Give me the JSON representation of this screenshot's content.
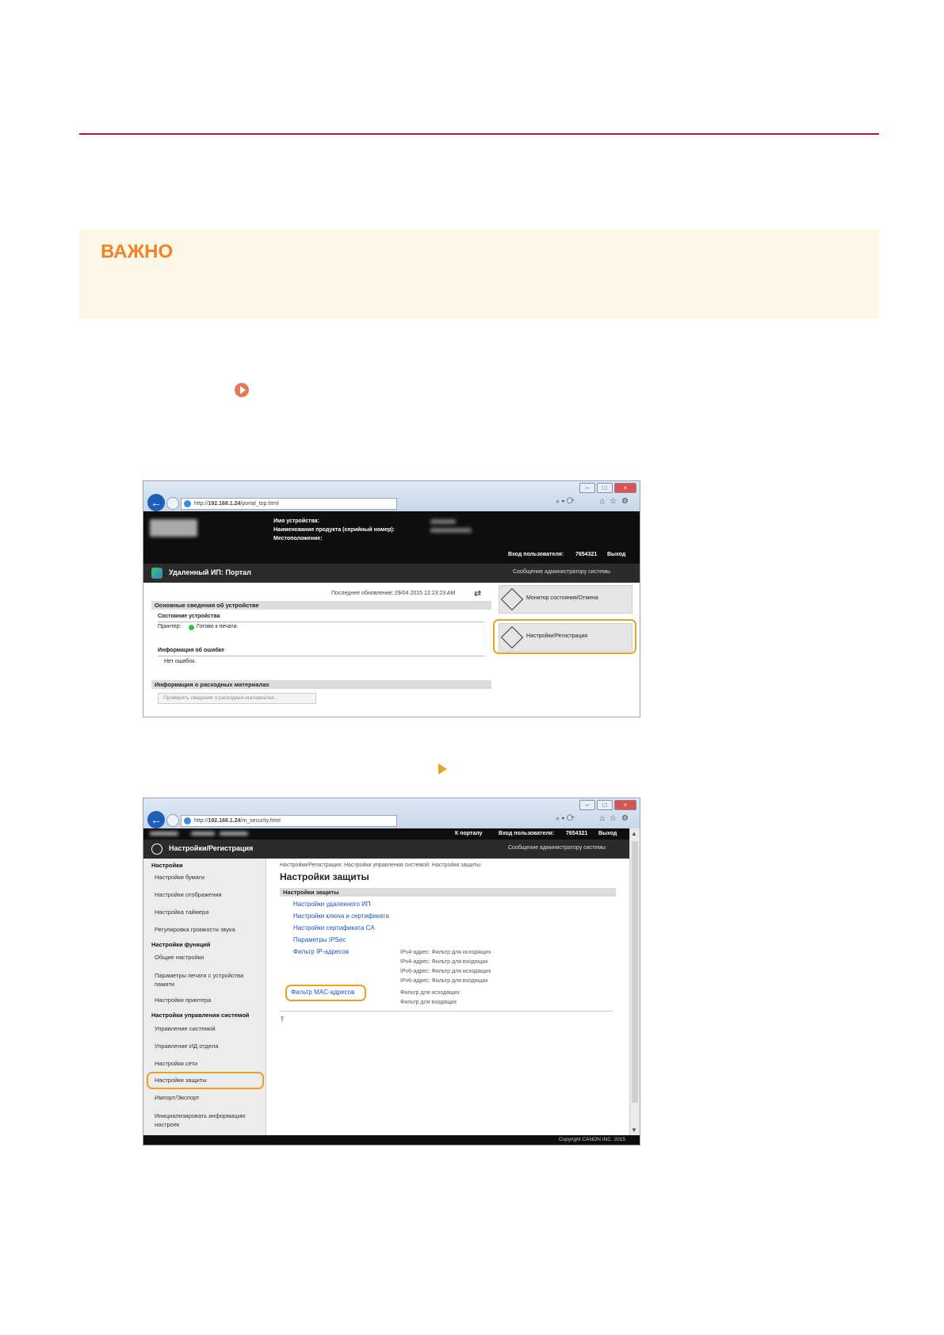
{
  "important": {
    "title": "ВАЖНО"
  },
  "shot1": {
    "url_prefix": "http://",
    "url_host": "192.168.1.24",
    "url_path": "/portal_top.html",
    "device_name_label": "Имя устройства:",
    "product_name_label": "Наименование продукта (серийный номер):",
    "location_label": "Местоположение:",
    "login_label": "Вход пользователя:",
    "login_id": "7654321",
    "logout": "Выход",
    "portal_title": "Удаленный ИП: Портал",
    "admin_message": "Сообщение администратору системы",
    "last_update_label": "Последнее обновление:",
    "last_update_value": "29/04 2015 12:23:23 AM",
    "basic_info": "Основные сведения об устройстве",
    "device_status": "Состояние устройства",
    "printer_label": "Принтер:",
    "printer_status": "Готово к печати.",
    "error_info": "Информация об ошибке",
    "no_errors": "Нет ошибок.",
    "consumables_info": "Информация о расходных материалах",
    "check_consumables": "Проверить сведения о расходных материалах...",
    "monitor_button": "Монитор состояния/Отмена",
    "settings_button": "Настройки/Регистрация"
  },
  "shot2": {
    "url_prefix": "http://",
    "url_host": "192.168.1.24",
    "url_path": "/m_security.html",
    "to_portal": "К порталу",
    "login_label": "Вход пользователя:",
    "login_id": "7654321",
    "logout": "Выход",
    "title": "Настройки/Регистрация",
    "admin_message": "Сообщение администратору системы",
    "sidebar": {
      "group_settings": "Настройки",
      "paper": "Настройки бумаги",
      "display": "Настройки отображения",
      "timer": "Настройка таймера",
      "volume": "Регулировка громкости звука",
      "group_functions": "Настройки функций",
      "common": "Общие настройки",
      "memory_print": "Параметры печати с устройства памяти",
      "printer": "Настройки принтера",
      "group_system": "Настройки управления системой",
      "system_mgmt": "Управление системой",
      "dept_id": "Управление ИД отдела",
      "network": "Настройки сети",
      "security": "Настройки защиты",
      "import_export": "Импорт/Экспорт",
      "init_settings": "Инициализировать информацию настроек"
    },
    "breadcrumb": "Настройки/Регистрация: Настройки управления системой: Настройки защиты",
    "page_title": "Настройки защиты",
    "section_head": "Настройки защиты",
    "links": {
      "remote_ui": "Настройки удаленного ИП",
      "key_cert": "Настройки ключа и сертификата",
      "ca_cert": "Настройки сертификата CA",
      "ipsec": "Параметры IPSec",
      "ip_filter": "Фильтр IP-адресов",
      "mac_filter": "Фильтр MAC-адресов"
    },
    "ip_filter_details": [
      "IPv4-адрес: Фильтр для исходящих",
      "IPv4-адрес: Фильтр для входящих",
      "IPv6-адрес: Фильтр для исходящих",
      "IPv6-адрес: Фильтр для входящих"
    ],
    "mac_filter_details": [
      "Фильтр для исходящих",
      "Фильтр для входящих"
    ],
    "copyright": "Copyright CANON INC. 2015"
  }
}
